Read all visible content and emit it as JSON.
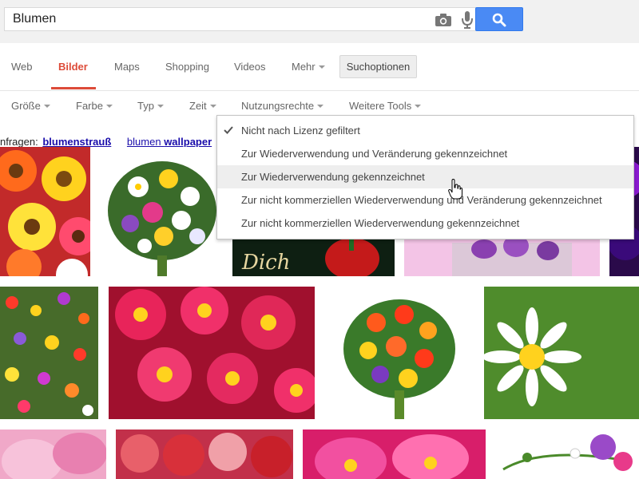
{
  "search": {
    "value": "Blumen"
  },
  "tabs": {
    "web": "Web",
    "images": "Bilder",
    "maps": "Maps",
    "shopping": "Shopping",
    "videos": "Videos",
    "more": "Mehr",
    "search_tools": "Suchoptionen",
    "active_color": "#dd4b39"
  },
  "tools": {
    "size": "Größe",
    "color": "Farbe",
    "type": "Typ",
    "time": "Zeit",
    "usage_rights": "Nutzungsrechte",
    "more_tools": "Weitere Tools"
  },
  "related": {
    "prefix": "nfragen:",
    "link1": "blumenstrauß",
    "link2_a": "blumen",
    "link2_b": "wallpaper"
  },
  "usage_menu": {
    "items": [
      {
        "label": "Nicht nach Lizenz gefiltert",
        "checked": true
      },
      {
        "label": "Zur Wiederverwendung und Veränderung gekennzeichnet",
        "checked": false
      },
      {
        "label": "Zur Wiederverwendung gekennzeichnet",
        "checked": false,
        "hovered": true
      },
      {
        "label": "Zur nicht kommerziellen Wiederverwendung und Veränderung gekennzeichnet",
        "checked": false
      },
      {
        "label": "Zur nicht kommerziellen Wiederverwendung gekennzeichnet",
        "checked": false
      }
    ]
  },
  "images": {
    "overlay_text": "Dich",
    "thumbnail_count": 14
  },
  "icons": {
    "camera": "camera-icon",
    "microphone": "microphone-icon",
    "search": "search-icon",
    "check": "check-icon",
    "pointer": "hand-cursor-icon"
  },
  "colors": {
    "search_button": "#4a8af4",
    "link": "#1a0dab",
    "header_bg": "#f1f1f1"
  }
}
